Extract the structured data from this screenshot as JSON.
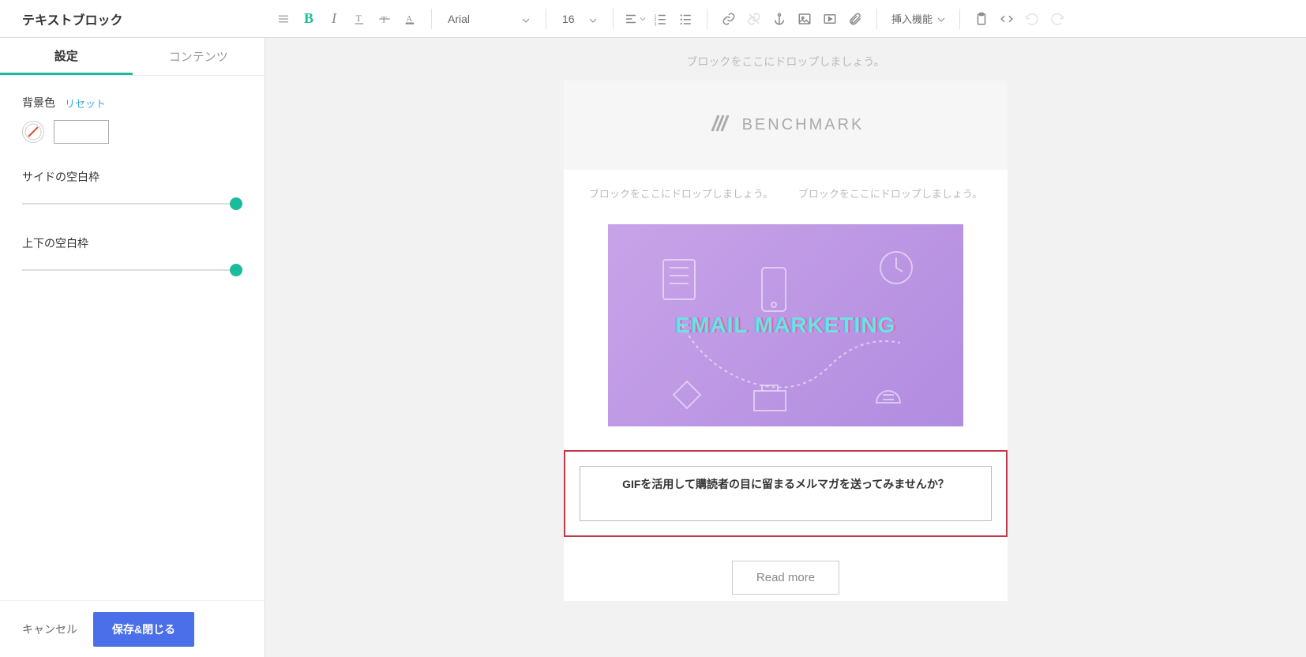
{
  "sidebar_title": "テキストブロック",
  "tabs": {
    "settings": "設定",
    "contents": "コンテンツ"
  },
  "toolbar": {
    "font_family": "Arial",
    "font_size": "16",
    "insert_feature": "挿入機能"
  },
  "panel": {
    "bg_color_label": "背景色",
    "reset": "リセット",
    "side_padding_label": "サイドの空白枠",
    "vertical_padding_label": "上下の空白枠"
  },
  "footer": {
    "cancel": "キャンセル",
    "save_close": "保存&閉じる"
  },
  "canvas": {
    "dropzone_text": "ブロックをここにドロップしましょう。",
    "brand": "BENCHMARK",
    "hero_text": "EMAIL MARKETING",
    "text_block_content": "GIFを活用して購読者の目に留まるメルマガを送ってみませんか？",
    "cta": "Read more"
  }
}
